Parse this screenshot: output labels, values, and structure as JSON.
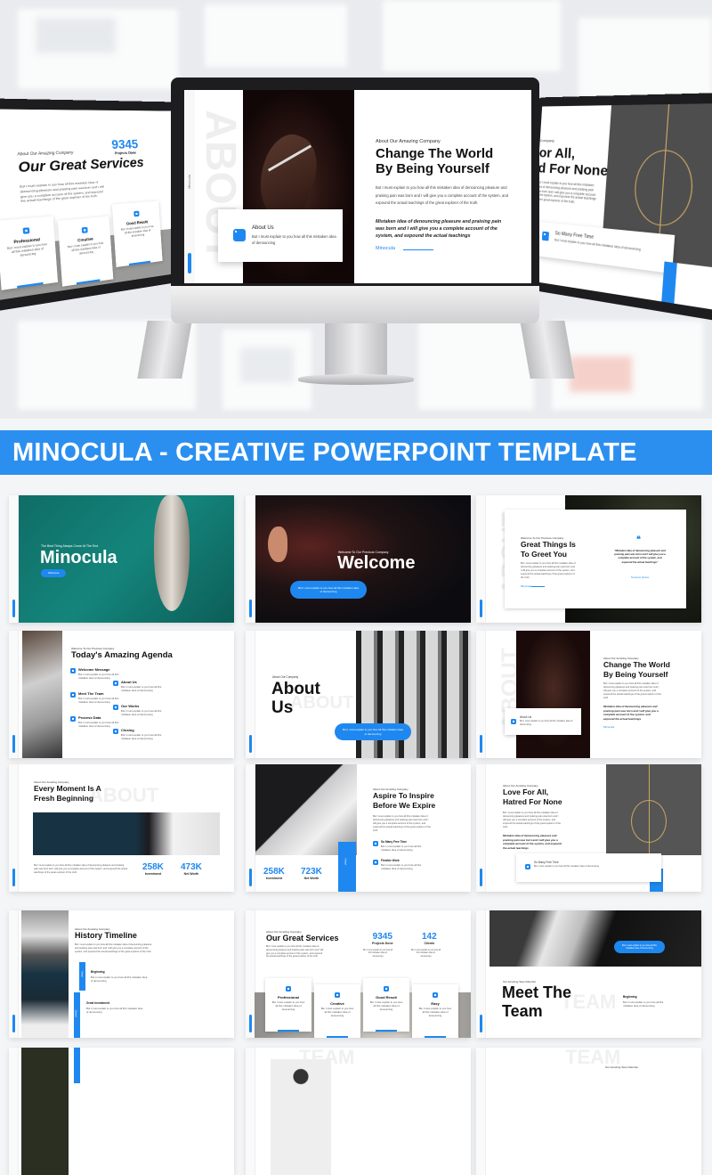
{
  "banner": {
    "title": "MINOCULA - CREATIVE POWERPOINT TEMPLATE"
  },
  "accent_color": "#1e88f0",
  "banner_color": "#2b8ff0",
  "common": {
    "body": "But I must explain to you how all this mistaken idea of denouncing pleasure and praising pain was born and I will give you a complete account of the system, and expound the actual teachings of the great explorer of the truth.",
    "short": "But I must explain to you how all this mistaken idea of denouncing",
    "brand": "Minocula",
    "about_wm": "ABOUT",
    "team_wm": "TEAM"
  },
  "hero": {
    "center": {
      "brand_vertical": "Minocula",
      "watermark": "ABOUT",
      "subtitle": "About Our Amazing Company",
      "title_l1": "Change The World",
      "title_l2": "By Being Yourself",
      "body": "But I must explain to you how all this mistaken idea of denouncing pleasure and praising pain was born and I will give you a complete account of the system, and expound the actual teachings of the great explorer of the truth.",
      "quote": "Mistaken idea of denouncing pleasure and praising pain was born and I will give you a complete account of the system, and expound the actual teachings",
      "link": "Minocula",
      "box_title": "About Us",
      "box_text": "But I must explain to you how all this mistaken idea of denouncing"
    },
    "left": {
      "subtitle": "About Our Amazing Company",
      "title": "Our Great Services",
      "stat_value": "9345",
      "stat_label": "Projects Done",
      "cards": [
        "Professional",
        "Creative",
        "Good Result"
      ]
    },
    "right": {
      "subtitle": "Company",
      "title_l1": "or All,",
      "title_l2": "d For None",
      "box_title": "So Many Free Time"
    }
  },
  "slides": [
    {
      "subtitle": "The Best Thing Always Come At The End",
      "title": "Minocula",
      "button": "Welcome"
    },
    {
      "subtitle": "Welcome To Our Precious Company",
      "title": "Welcome",
      "button": "But I must explain to you how all this mistaken idea of denouncing"
    },
    {
      "subtitle": "Welcome To Our Precious Company",
      "title_l1": "Great Things Is",
      "title_l2": "To Greet You",
      "link": "Minocula",
      "quote": "\"Mistaken idea of denouncing pleasure and praising pain was born and I will give you a complete account of the system, and expound the actual teachings\"",
      "quote_author": "Someone Quotes"
    },
    {
      "subtitle": "Welcome To Our Precious Company",
      "title": "Today's Amazing Agenda",
      "items": [
        "Welcome Message",
        "Meet The Team",
        "Process Data",
        "About Us",
        "Our Works",
        "Closing"
      ]
    },
    {
      "subtitle": "About Our Company",
      "title_l1": "About",
      "title_l2": "Us",
      "watermark": "ABOUT",
      "button": "But I must explain to you how all this mistaken idea of denouncing"
    },
    {
      "subtitle": "About Our Amazing Company",
      "title_l1": "Change The World",
      "title_l2": "By Being Yourself",
      "quote": "Mistaken idea of denouncing pleasure and praising pain was born and I will give you a complete account of the system, and expound the actual teachings",
      "link": "Minocula",
      "box_title": "About Us"
    },
    {
      "subtitle": "About Our Amazing Company",
      "title_l1": "Every Moment Is A",
      "title_l2": "Fresh Beginning",
      "stats": [
        {
          "value": "258K",
          "label": "Investment"
        },
        {
          "value": "473K",
          "label": "Net Worth"
        }
      ]
    },
    {
      "subtitle": "About Our Amazing Company",
      "title_l1": "Aspire To Inspire",
      "title_l2": "Before We Expire",
      "stats": [
        {
          "value": "258K",
          "label": "Investment"
        },
        {
          "value": "723K",
          "label": "Net Worth"
        }
      ],
      "items": [
        "So Many Free Time",
        "Flexible Work"
      ],
      "bar_label": "Head"
    },
    {
      "subtitle": "About Our Amazing Company",
      "title_l1": "Love For All,",
      "title_l2": "Hatred For None",
      "quote": "Mistaken idea of denouncing pleasure and praising pain was born and I will give you a complete account of the system, and expound the actual teachings",
      "box_title": "So Many Free Time"
    },
    {
      "subtitle": "About Our Amazing Company",
      "title": "History Timeline",
      "items": [
        "Beginning",
        "Great Investment"
      ],
      "bar_labels": [
        "Head",
        "Upload"
      ]
    },
    {
      "subtitle": "About Our Amazing Company",
      "title": "Our Great Services",
      "stats": [
        {
          "value": "9345",
          "label": "Projects Done"
        },
        {
          "value": "142",
          "label": "Clients"
        }
      ],
      "cards": [
        "Professional",
        "Creative",
        "Good Result",
        "Easy"
      ]
    },
    {
      "subtitle": "Our Amazing Team Member",
      "title_l1": "Meet The",
      "title_l2": "Team",
      "watermark": "TEAM",
      "item": "Beginning",
      "button": "But I must explain to you how all this mistaken idea of denouncing"
    },
    {
      "watermark": "TEAM",
      "subtitle": "Our Amazing Team Member"
    }
  ]
}
